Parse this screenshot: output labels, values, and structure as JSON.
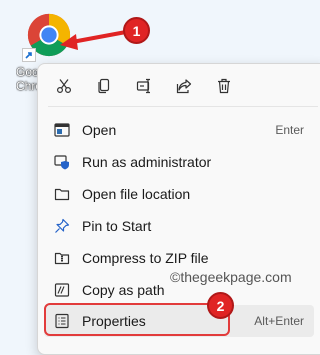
{
  "desktop": {
    "icon_label_line1": "Google",
    "icon_label_line2": "Chrome"
  },
  "toolbar": {
    "icons": [
      "cut-icon",
      "copy-icon",
      "rename-icon",
      "share-icon",
      "delete-icon"
    ]
  },
  "menu": {
    "items": [
      {
        "label": "Open",
        "shortcut": "Enter",
        "icon": "open-icon"
      },
      {
        "label": "Run as administrator",
        "shortcut": "",
        "icon": "shield-icon"
      },
      {
        "label": "Open file location",
        "shortcut": "",
        "icon": "folder-icon"
      },
      {
        "label": "Pin to Start",
        "shortcut": "",
        "icon": "pin-icon"
      },
      {
        "label": "Compress to ZIP file",
        "shortcut": "",
        "icon": "zip-folder-icon"
      },
      {
        "label": "Copy as path",
        "shortcut": "",
        "icon": "copy-path-icon"
      },
      {
        "label": "Properties",
        "shortcut": "Alt+Enter",
        "icon": "properties-icon"
      }
    ]
  },
  "watermark": "©thegeekpage.com",
  "annotations": {
    "badge1": "1",
    "badge2": "2",
    "color": "#e02424"
  }
}
